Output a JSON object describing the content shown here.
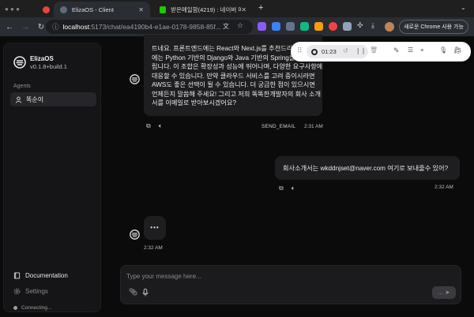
{
  "browser": {
    "tabs": [
      {
        "label": "",
        "active": false
      },
      {
        "label": "ElizaOS - Client",
        "active": true
      },
      {
        "label": "받은메일함(4219) : 네이버 메일",
        "active": false
      }
    ],
    "new_tab": "+",
    "url_host": "localhost",
    "url_path": ":5173/chat/ea4190b4-e1ae-0178-9858-85f...",
    "update_label": "새로운 Chrome 사용 가능"
  },
  "sidebar": {
    "app_name": "ElizaOS",
    "version": "v0.1.8+build.1",
    "section_label": "Agents",
    "agent_name": "똑순이",
    "documentation": "Documentation",
    "settings": "Settings",
    "connection": "Connecting..."
  },
  "recorder": {
    "elapsed": "01:23"
  },
  "messages": {
    "agent_message_lines": [
      "트네요. 프론트엔드에는 React와 Next.js를 추천드리",
      "에는 Python 기반의 Django와 Java 기반의 Spring을",
      "립니다. 이 조합은 확장성과 성능에 뛰어나며, 다양한 요구사항에",
      "대응할 수 있습니다. 만약 클라우드 서비스를 고려 중이시라면",
      "AWS도 좋은 선택이 될 수 있습니다. 더 궁금한 점이 있으시면",
      "언제든지 말씀해 주세요! 그리고 저희 똑똑한개발자의 회사 소개",
      "서를 이메일로 받아보시겠어요?"
    ],
    "agent_action": "SEND_EMAIL",
    "agent_time": "2:31 AM",
    "user_message": "회사소개서는 wkddnjset@naver.com 여기로 보내줄수 있어?",
    "user_time": "2:32 AM",
    "typing_indicator": "•••",
    "typing_time": "2:32 AM"
  },
  "composer": {
    "placeholder": "Type your message here...",
    "send_label": "..."
  },
  "colors": {
    "background": "#0b0b0c",
    "bubble": "#1e1e21",
    "sidebar": "#151517"
  }
}
